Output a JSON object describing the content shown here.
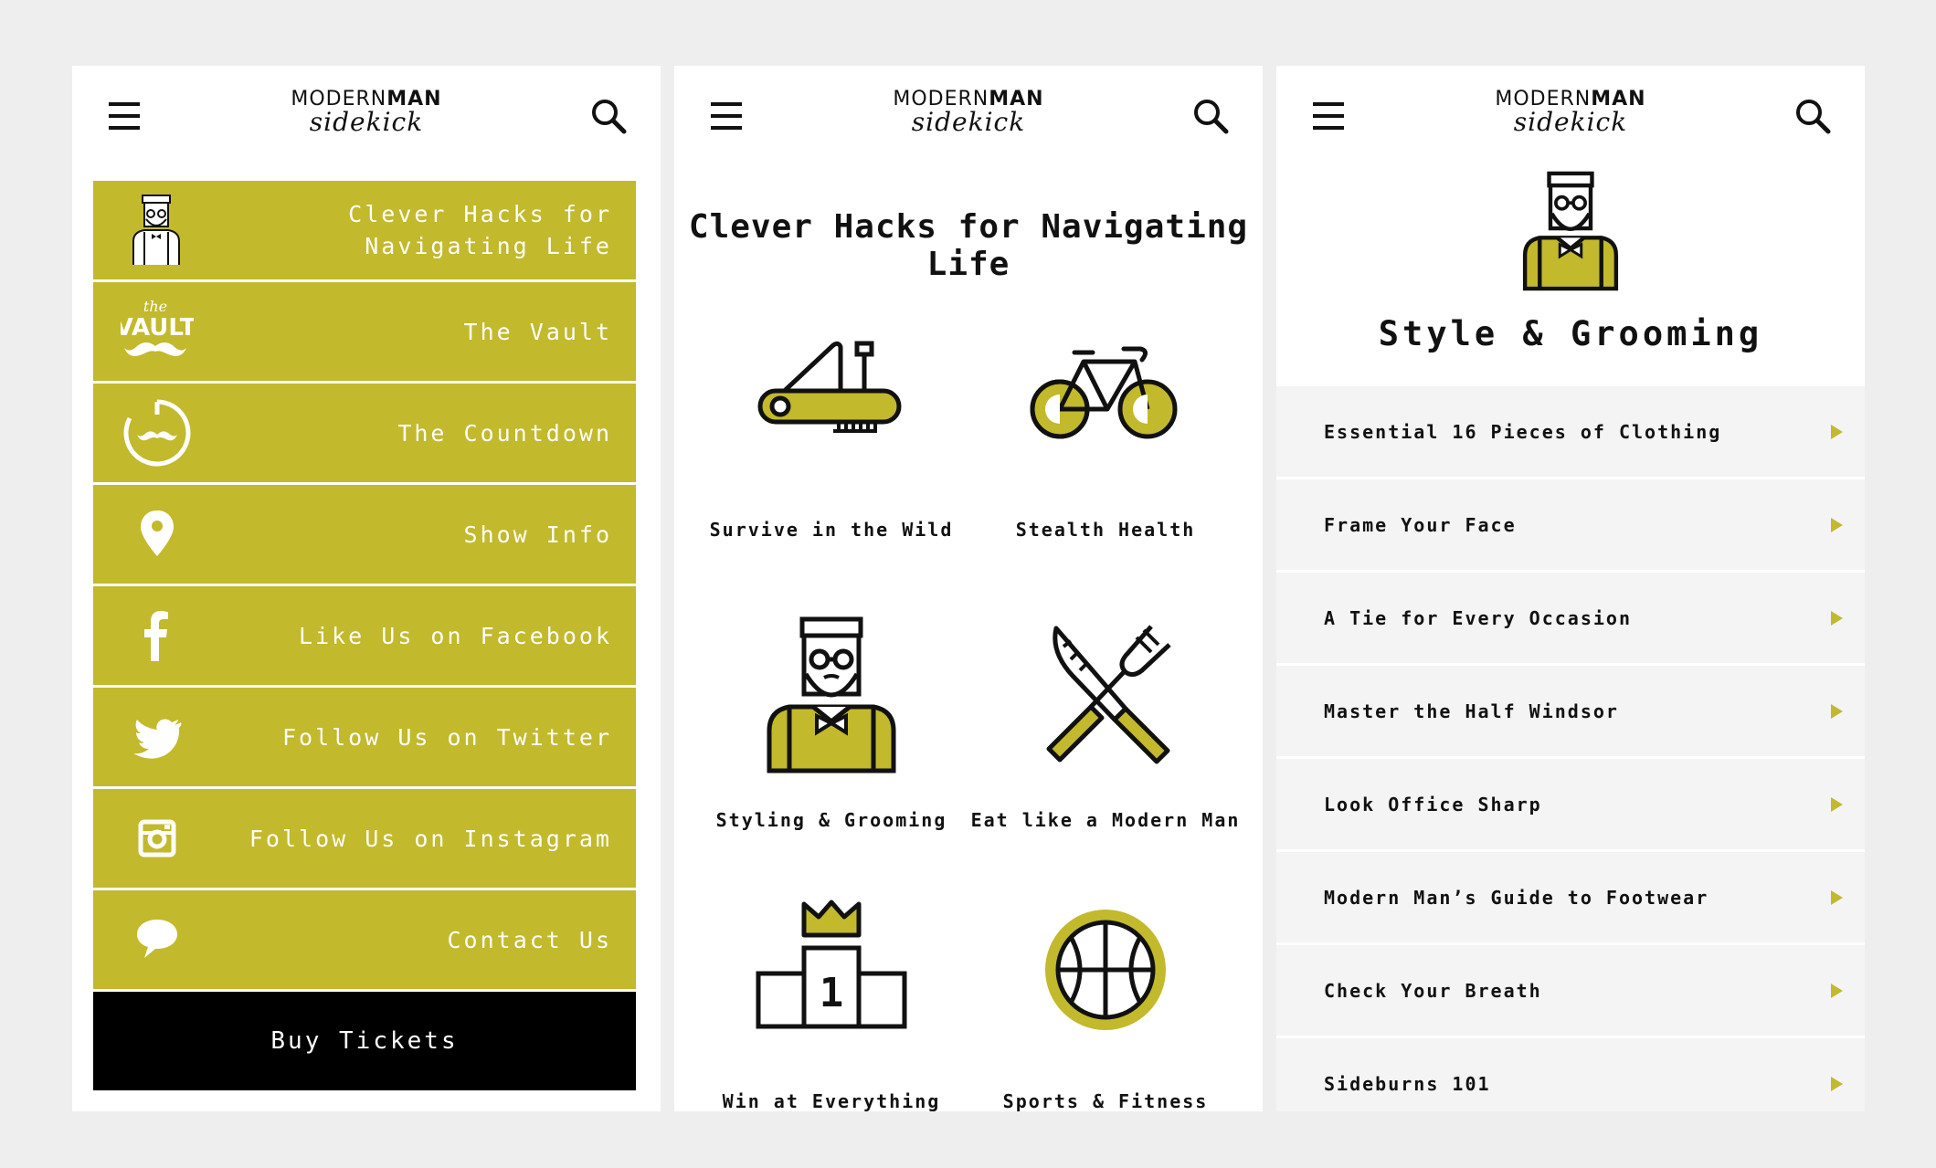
{
  "brand": {
    "logo_top_regular": "MODERN",
    "logo_top_bold": "MAN",
    "logo_sub": "sidekick"
  },
  "colors": {
    "accent": "#c2b92c",
    "background": "#eeeeee",
    "panel": "#ffffff",
    "buy_bg": "#000000"
  },
  "menu_panel": {
    "items": [
      {
        "label": "Clever Hacks for Navigating Life",
        "icon": "hipster-man-icon"
      },
      {
        "label": "The Vault",
        "icon": "vault-mustache-logo-icon",
        "icon_text_top": "the",
        "icon_text_main": "VAULT"
      },
      {
        "label": "The Countdown",
        "icon": "countdown-mustache-icon"
      },
      {
        "label": "Show Info",
        "icon": "location-pin-icon"
      },
      {
        "label": "Like Us on Facebook",
        "icon": "facebook-icon"
      },
      {
        "label": "Follow Us on Twitter",
        "icon": "twitter-icon"
      },
      {
        "label": "Follow Us on Instagram",
        "icon": "instagram-icon"
      },
      {
        "label": "Contact Us",
        "icon": "chat-bubble-icon"
      }
    ],
    "buy_label": "Buy Tickets"
  },
  "hacks_panel": {
    "title": "Clever Hacks for Navigating Life",
    "tiles": [
      {
        "label": "Survive in the Wild",
        "icon": "pocket-knife-icon"
      },
      {
        "label": "Stealth Health",
        "icon": "bicycle-icon"
      },
      {
        "label": "Styling & Grooming",
        "icon": "hipster-man-icon"
      },
      {
        "label": "Eat like a Modern Man",
        "icon": "knife-fork-icon"
      },
      {
        "label": "Win at Everything",
        "icon": "podium-crown-icon",
        "podium_number": "1"
      },
      {
        "label": "Sports & Fitness",
        "icon": "basketball-icon"
      }
    ]
  },
  "style_panel": {
    "title": "Style & Grooming",
    "items": [
      "Essential 16 Pieces of Clothing",
      "Frame Your Face",
      "A Tie for Every Occasion",
      "Master the Half Windsor",
      "Look Office Sharp",
      "Modern Man’s Guide to Footwear",
      "Check Your Breath",
      "Sideburns 101"
    ]
  }
}
